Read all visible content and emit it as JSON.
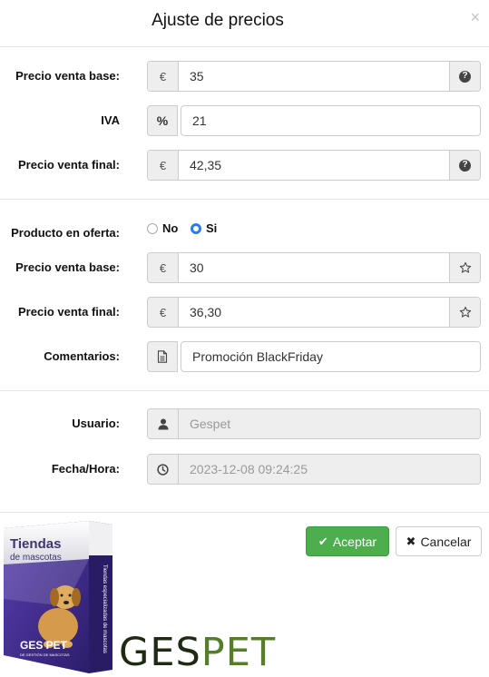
{
  "header": {
    "title": "Ajuste de precios",
    "close": "×"
  },
  "section1": {
    "base": {
      "label": "Precio venta base:",
      "addon": "€",
      "value": "35"
    },
    "iva": {
      "label": "IVA",
      "addon": "%",
      "value": "21"
    },
    "final": {
      "label": "Precio venta final:",
      "addon": "€",
      "value": "42,35"
    }
  },
  "offer": {
    "label": "Producto en oferta:",
    "options": [
      {
        "label": "No",
        "selected": false
      },
      {
        "label": "Si",
        "selected": true
      }
    ],
    "base": {
      "label": "Precio venta base:",
      "addon": "€",
      "value": "30"
    },
    "final": {
      "label": "Precio venta final:",
      "addon": "€",
      "value": "36,30"
    },
    "comments": {
      "label": "Comentarios:",
      "value": "Promoción BlackFriday"
    }
  },
  "meta": {
    "user": {
      "label": "Usuario:",
      "value": "Gespet"
    },
    "datetime": {
      "label": "Fecha/Hora:",
      "value": "2023-12-08 09:24:25"
    }
  },
  "buttons": {
    "accept": "Aceptar",
    "cancel": "Cancelar"
  },
  "product_box": {
    "line1": "Tiendas",
    "line2": "de mascotas",
    "spine": "Tiendas especializadas de mascotas",
    "logo": "GES PET",
    "logo_sub": "DE GESTIÓN DE MASCOTAS"
  },
  "brand": {
    "part1": "GES",
    "part2": "PET"
  },
  "colors": {
    "accent": "#2b7de9",
    "success": "#4cae4c",
    "brand_green": "#567d2b",
    "box_purple": "#3d2a86"
  }
}
